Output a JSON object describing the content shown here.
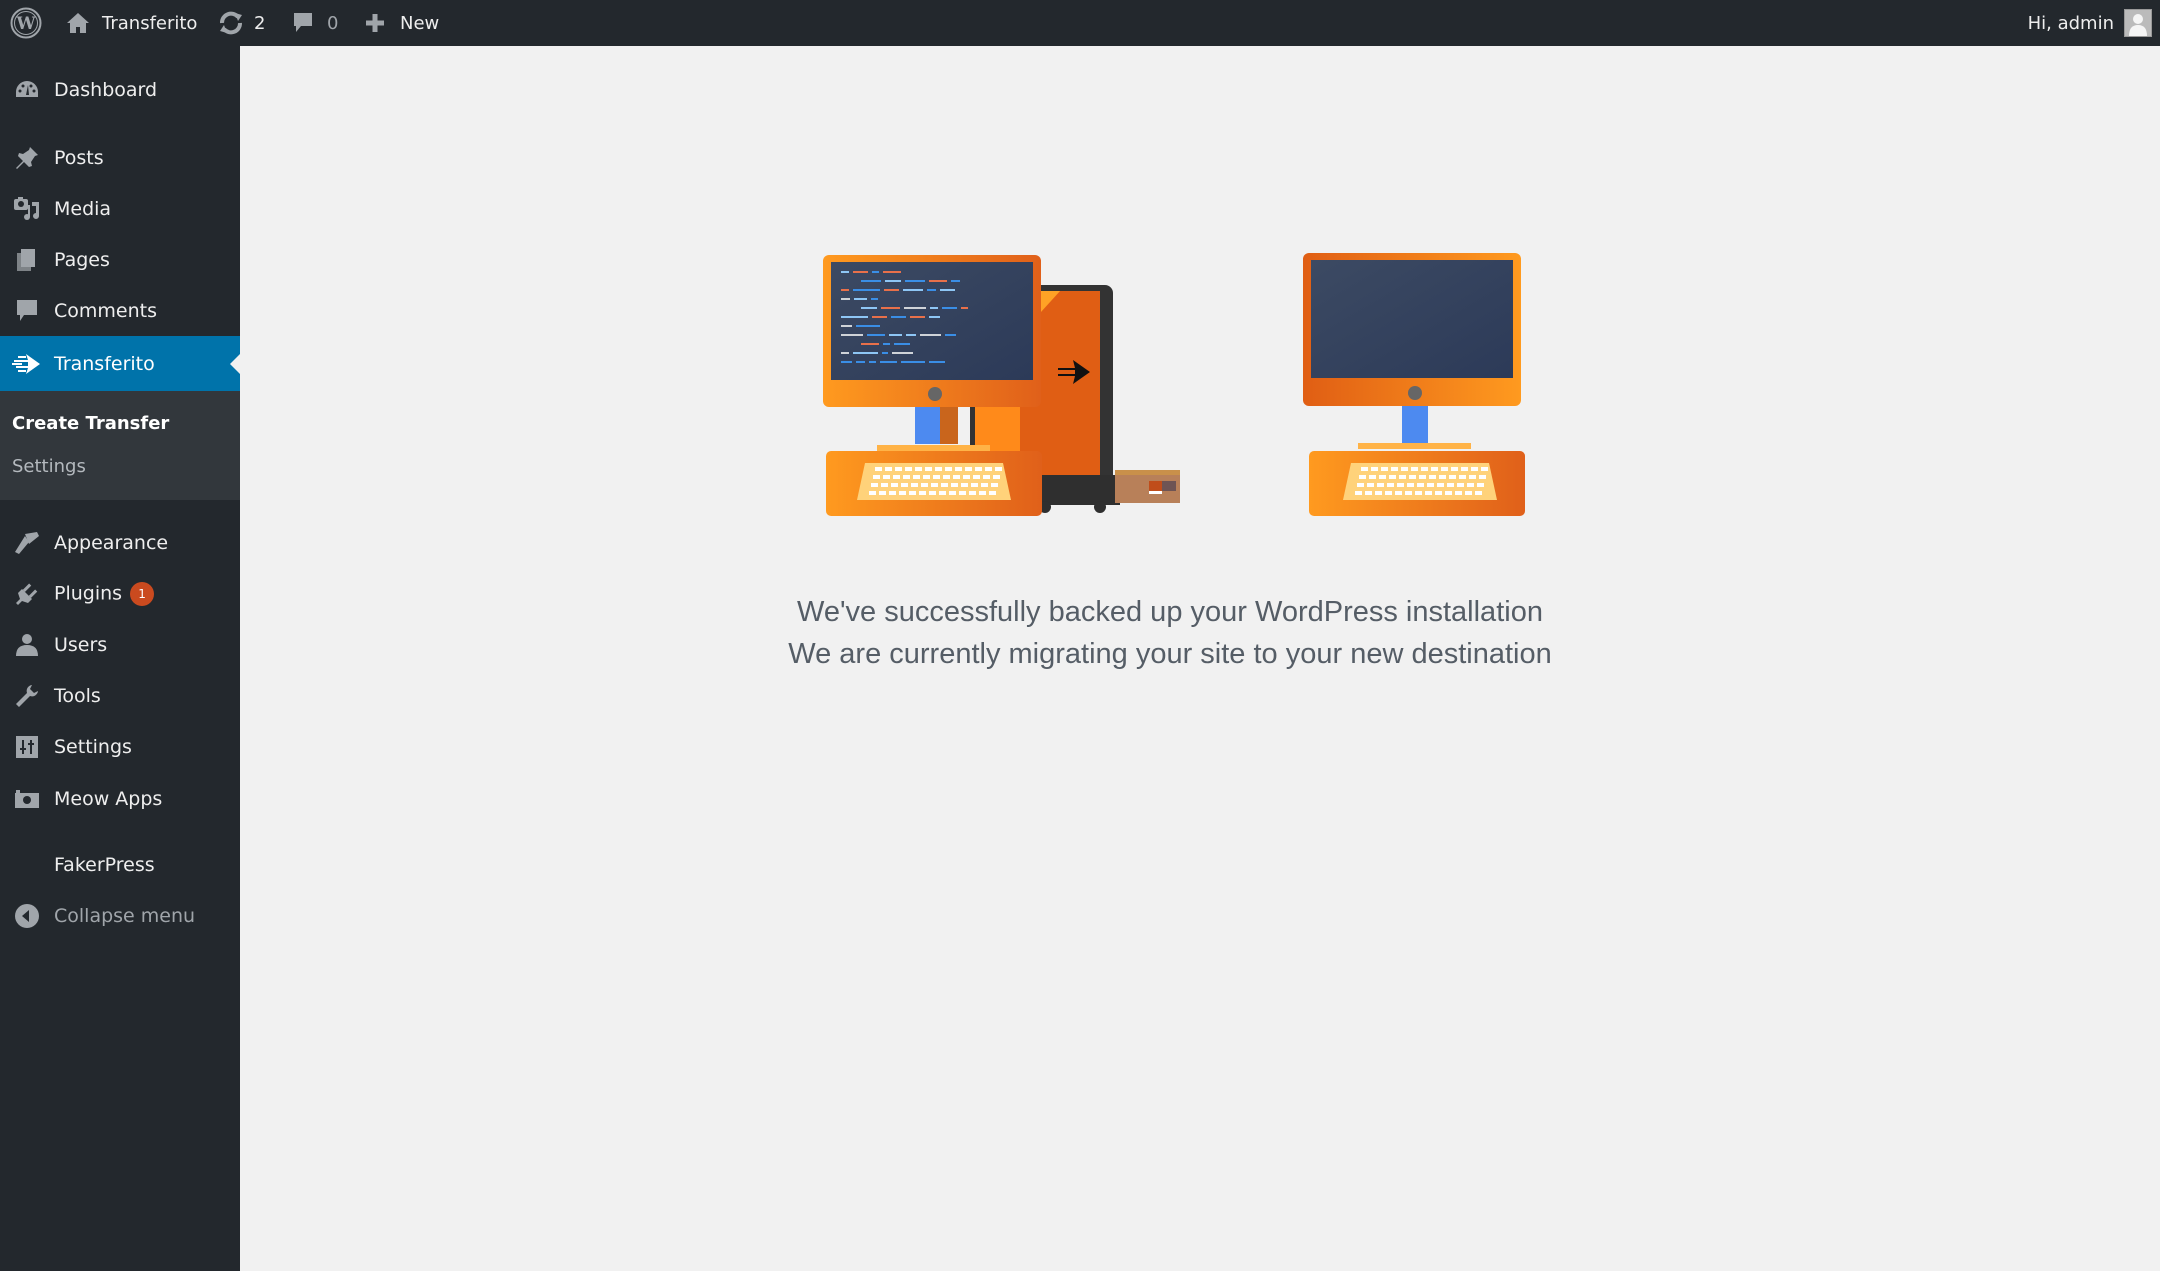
{
  "adminbar": {
    "site_name": "Transferito",
    "updates_count": "2",
    "comments_count": "0",
    "new_label": "New",
    "greeting": "Hi, admin",
    "bg_color": "#23282d"
  },
  "sidebar": {
    "items": [
      {
        "label": "Dashboard",
        "icon": "dashboard-icon"
      },
      {
        "label": "Posts",
        "icon": "pin-icon"
      },
      {
        "label": "Media",
        "icon": "media-icon"
      },
      {
        "label": "Pages",
        "icon": "pages-icon"
      },
      {
        "label": "Comments",
        "icon": "comment-icon"
      },
      {
        "label": "Transferito",
        "icon": "transferito-arrow-icon",
        "active": true
      },
      {
        "label": "Appearance",
        "icon": "paintbrush-icon"
      },
      {
        "label": "Plugins",
        "icon": "plugin-icon",
        "badge": "1"
      },
      {
        "label": "Users",
        "icon": "user-icon"
      },
      {
        "label": "Tools",
        "icon": "wrench-icon"
      },
      {
        "label": "Settings",
        "icon": "sliders-icon"
      },
      {
        "label": "Meow Apps",
        "icon": "camera-icon"
      },
      {
        "label": "FakerPress",
        "icon": ""
      },
      {
        "label": "Collapse menu",
        "icon": "collapse-icon"
      }
    ],
    "submenu": [
      {
        "label": "Create Transfer",
        "current": true
      },
      {
        "label": "Settings",
        "current": false
      }
    ],
    "active_color": "#0073aa",
    "badge_color": "#ca4a1f"
  },
  "main": {
    "message_line1": "We've successfully backed up your WordPress installation",
    "message_line2": "We are currently migrating your site to your new destination",
    "illustration": "source-computer-transfer-to-destination-computer"
  }
}
